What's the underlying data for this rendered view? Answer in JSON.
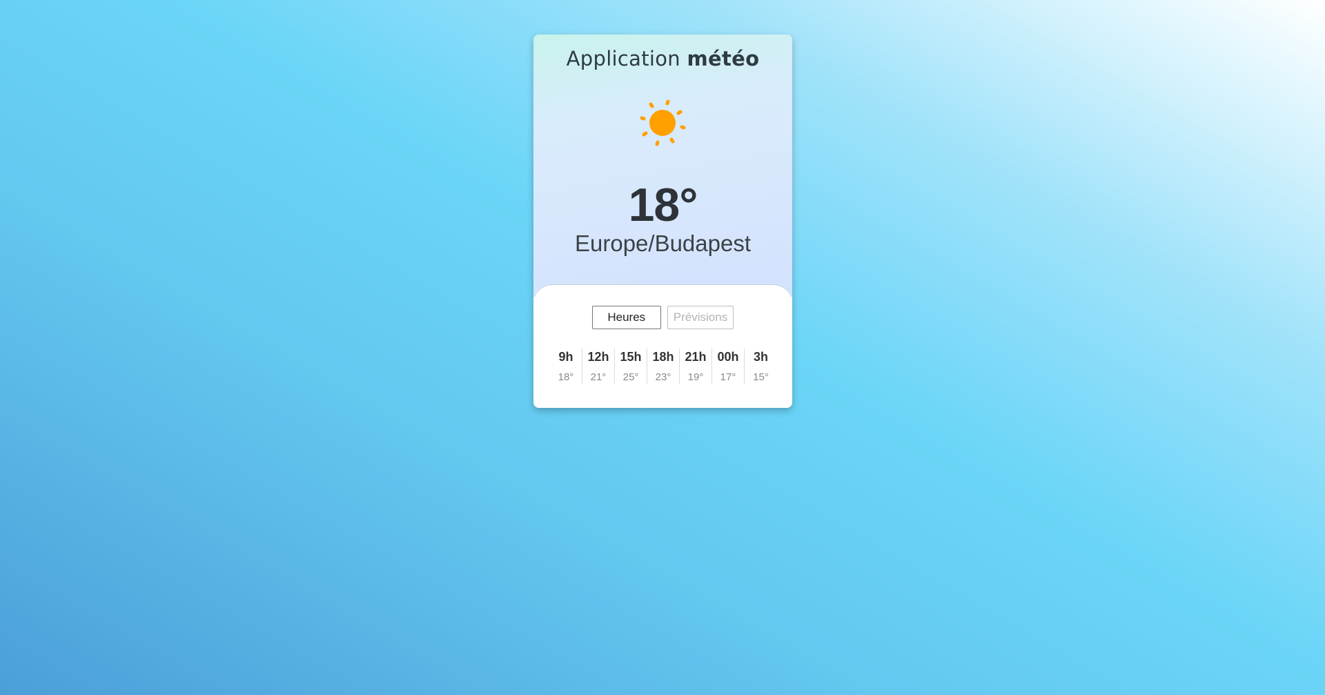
{
  "app": {
    "title_prefix": "Application",
    "title_bold": "météo"
  },
  "weather": {
    "icon": "sun-icon",
    "temperature": "18°",
    "location": "Europe/Budapest"
  },
  "tabs": [
    {
      "label": "Heures",
      "active": true
    },
    {
      "label": "Prévisions",
      "active": false
    }
  ],
  "hourly": [
    {
      "hour": "9h",
      "temp": "18°"
    },
    {
      "hour": "12h",
      "temp": "21°"
    },
    {
      "hour": "15h",
      "temp": "25°"
    },
    {
      "hour": "18h",
      "temp": "23°"
    },
    {
      "hour": "21h",
      "temp": "19°"
    },
    {
      "hour": "00h",
      "temp": "17°"
    },
    {
      "hour": "3h",
      "temp": "15°"
    }
  ],
  "colors": {
    "sun": "#ffa000",
    "text_dark": "#2d3338"
  }
}
